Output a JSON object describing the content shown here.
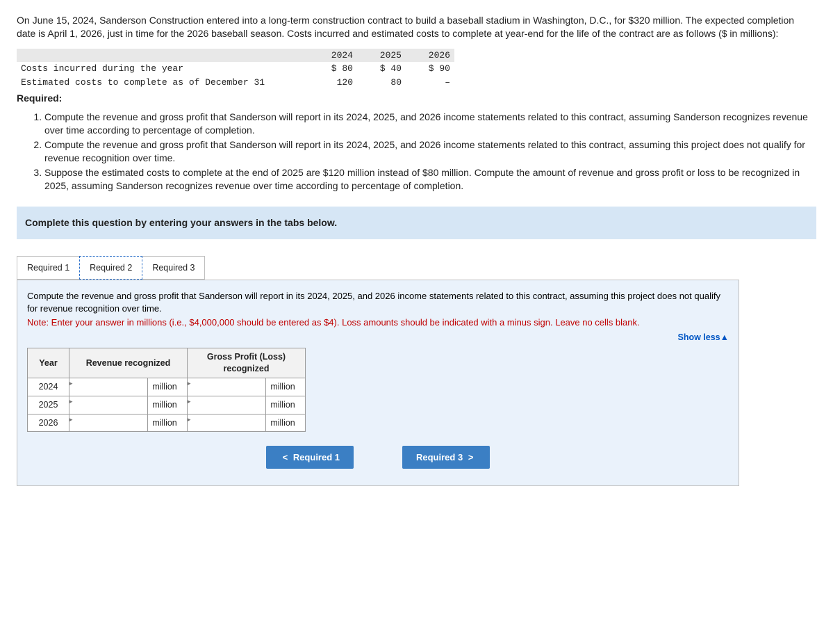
{
  "problem": {
    "text": "On June 15, 2024, Sanderson Construction entered into a long-term construction contract to build a baseball stadium in Washington, D.C., for $320 million. The expected completion date is April 1, 2026, just in time for the 2026 baseball season. Costs incurred and estimated costs to complete at year-end for the life of the contract are as follows ($ in millions):"
  },
  "cost_table": {
    "years": [
      "2024",
      "2025",
      "2026"
    ],
    "rows": [
      {
        "label": "Costs incurred during the year",
        "vals": [
          "$ 80",
          "$ 40",
          "$ 90"
        ]
      },
      {
        "label": "Estimated costs to complete as of December 31",
        "vals": [
          "120",
          "80",
          "–"
        ]
      }
    ]
  },
  "required_label": "Required:",
  "requirements": [
    "Compute the revenue and gross profit that Sanderson will report in its 2024, 2025, and 2026 income statements related to this contract, assuming Sanderson recognizes revenue over time according to percentage of completion.",
    "Compute the revenue and gross profit that Sanderson will report in its 2024, 2025, and 2026 income statements related to this contract, assuming this project does not qualify for revenue recognition over time.",
    "Suppose the estimated costs to complete at the end of 2025 are $120 million instead of $80 million. Compute the amount of revenue and gross profit or loss to be recognized in 2025, assuming Sanderson recognizes revenue over time according to percentage of completion."
  ],
  "instruction_bar": "Complete this question by entering your answers in the tabs below.",
  "tabs": [
    {
      "label": "Required 1"
    },
    {
      "label": "Required 2"
    },
    {
      "label": "Required 3"
    }
  ],
  "panel": {
    "text": "Compute the revenue and gross profit that Sanderson will report in its 2024, 2025, and 2026 income statements related to this contract, assuming this project does not qualify for revenue recognition over time.",
    "note": "Note: Enter your answer in millions (i.e., $4,000,000 should be entered as $4). Loss amounts should be indicated with a minus sign. Leave no cells blank.",
    "show_less": "Show less",
    "headers": {
      "year": "Year",
      "rev": "Revenue recognized",
      "gp": "Gross Profit (Loss) recognized"
    },
    "years": [
      "2024",
      "2025",
      "2026"
    ],
    "unit": "million"
  },
  "nav": {
    "prev": "Required 1",
    "next": "Required 3"
  },
  "chevrons": {
    "left": "<",
    "right": ">",
    "up": "▲"
  }
}
